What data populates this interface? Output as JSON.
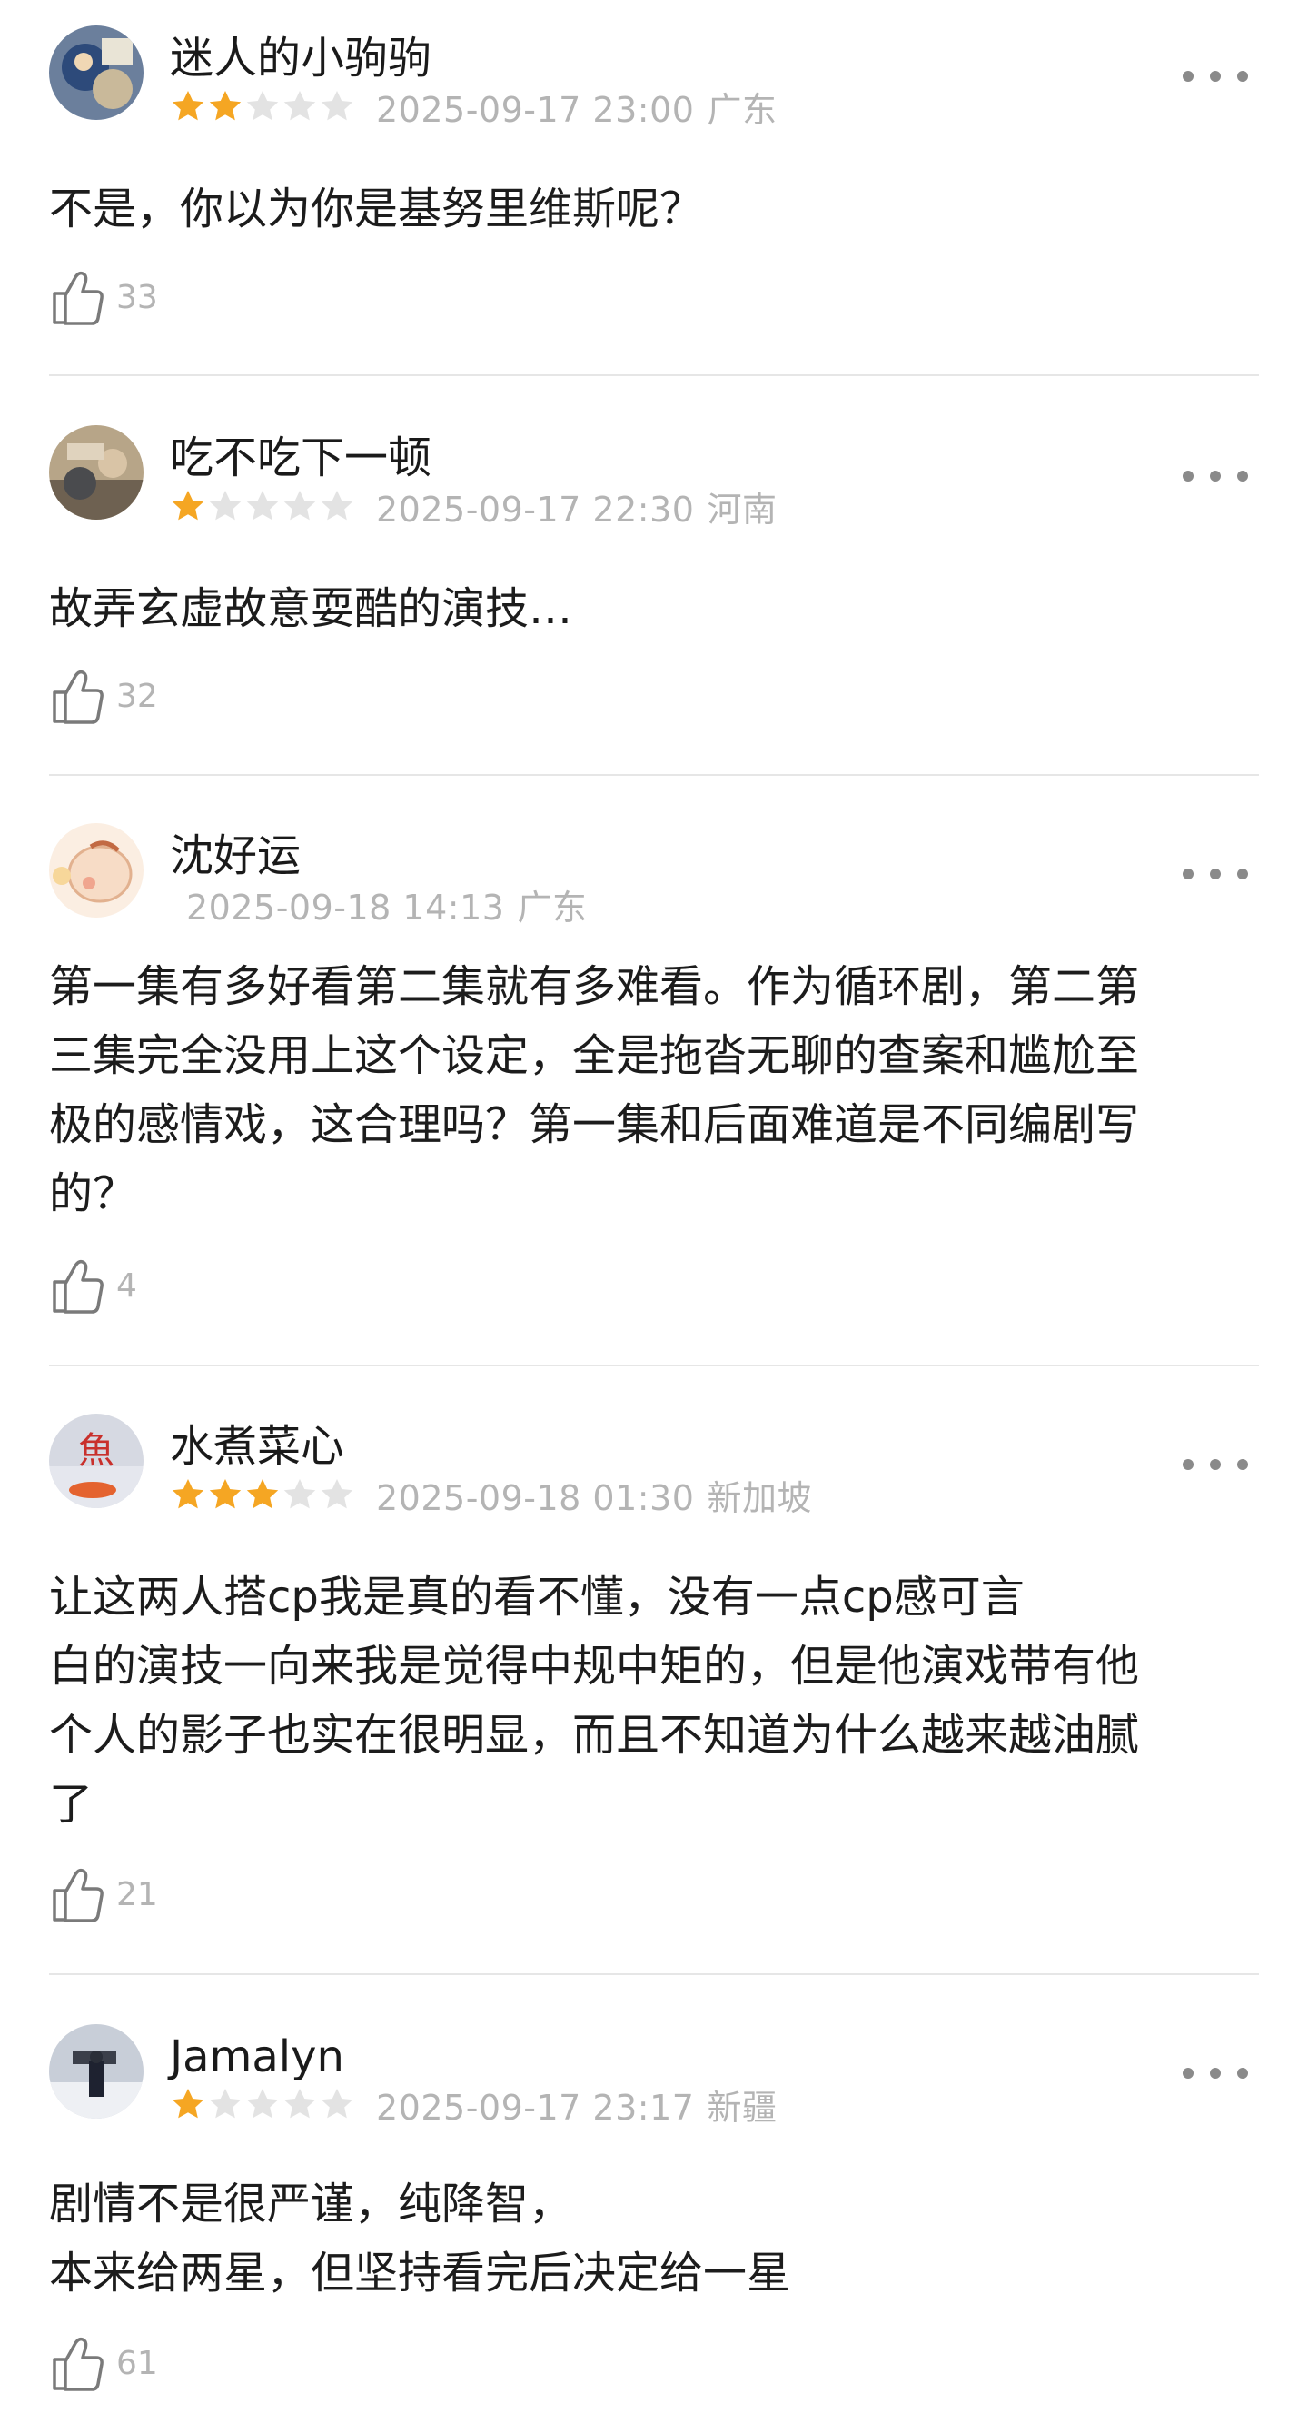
{
  "reviews": [
    {
      "username": "迷人的小驹驹",
      "rating": 2,
      "date": "2025-09-17 23:00",
      "location": "广东",
      "content": [
        "不是，你以为你是基努里维斯呢？"
      ],
      "likes": "33"
    },
    {
      "username": "吃不吃下一顿",
      "rating": 1,
      "date": "2025-09-17 22:30",
      "location": "河南",
      "content": [
        "故弄玄虚故意耍酷的演技…"
      ],
      "likes": "32"
    },
    {
      "username": "沈好运",
      "rating": 0,
      "date": "2025-09-18 14:13",
      "location": "广东",
      "content": [
        "第一集有多好看第二集就有多难看。作为循环剧，第二第",
        "三集完全没用上这个设定，全是拖沓无聊的查案和尴尬至",
        "极的感情戏，这合理吗？第一集和后面难道是不同编剧写",
        "的？"
      ],
      "likes": "4"
    },
    {
      "username": "水煮菜心",
      "rating": 3,
      "date": "2025-09-18 01:30",
      "location": "新加坡",
      "content": [
        "让这两人搭cp我是真的看不懂，没有一点cp感可言",
        "白的演技一向来我是觉得中规中矩的，但是他演戏带有他",
        "个人的影子也实在很明显，而且不知道为什么越来越油腻",
        "了"
      ],
      "likes": "21"
    },
    {
      "username": "Jamalyn",
      "rating": 1,
      "date": "2025-09-17 23:17",
      "location": "新疆",
      "content": [
        "剧情不是很严谨，纯降智，",
        "本来给两星，但坚持看完后决定给一星"
      ],
      "likes": "61"
    }
  ],
  "colors": {
    "star_filled": "#f5a623",
    "star_empty": "#e3e3e3",
    "meta_text": "#b4b4b4",
    "divider": "#e6e6e6"
  },
  "icons": {
    "more": "more-horizontal-icon",
    "like": "thumbs-up-icon",
    "star": "star-icon"
  }
}
